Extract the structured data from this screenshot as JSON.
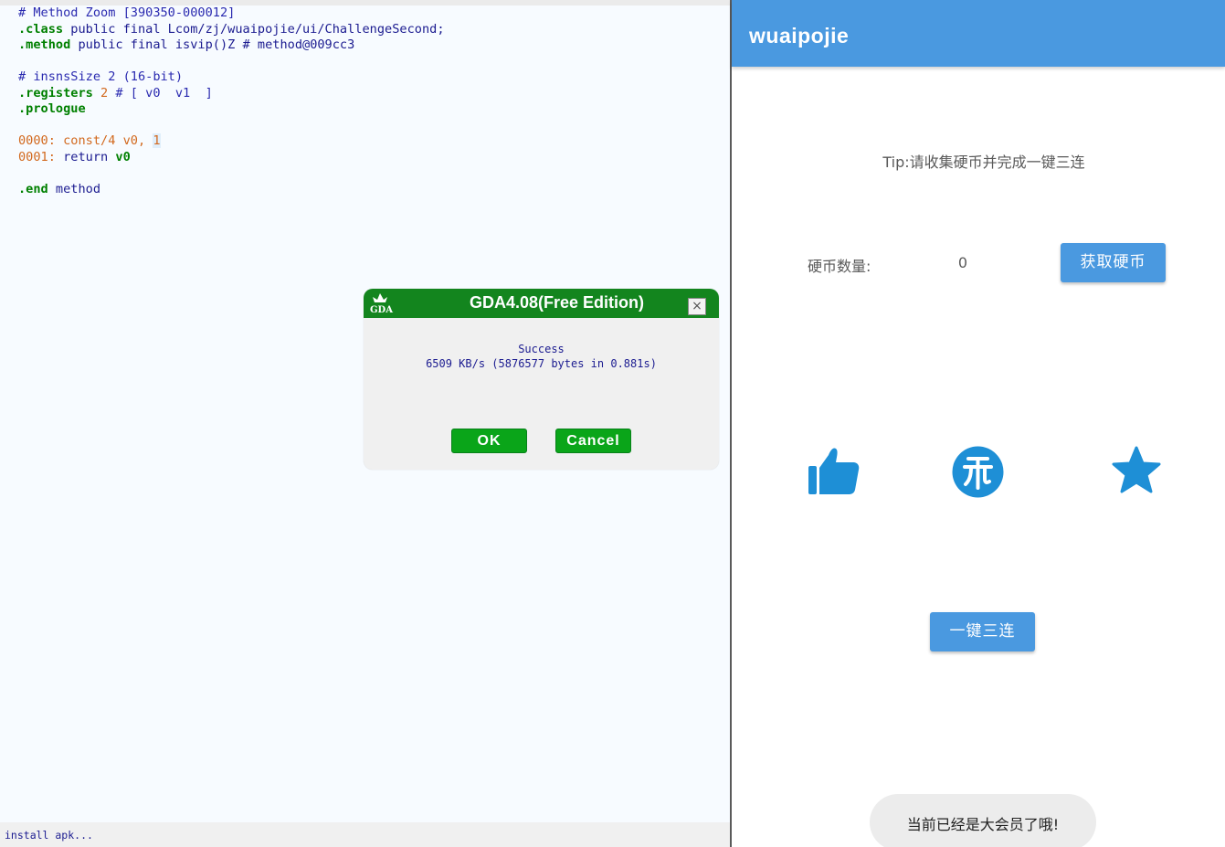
{
  "code_view": {
    "lines": [
      {
        "id": "l1",
        "segments": [
          {
            "cls": "c-comment",
            "text": "# Method Zoom [390350-000012]"
          }
        ]
      },
      {
        "id": "l2",
        "segments": [
          {
            "cls": "c-dir",
            "text": ".class"
          },
          {
            "cls": "c-text",
            "text": " public final Lcom/zj/wuaipojie/ui/ChallengeSecond;"
          }
        ]
      },
      {
        "id": "l3",
        "segments": [
          {
            "cls": "c-dir",
            "text": ".method"
          },
          {
            "cls": "c-text",
            "text": " public final isvip()Z # method@009cc3"
          }
        ]
      },
      {
        "id": "l4",
        "blank": true
      },
      {
        "id": "l5",
        "segments": [
          {
            "cls": "c-comment",
            "text": "# insnsSize 2 (16-bit)"
          }
        ]
      },
      {
        "id": "l6",
        "segments": [
          {
            "cls": "c-dir",
            "text": ".registers"
          },
          {
            "cls": "c-reg",
            "text": " 2"
          },
          {
            "cls": "c-comment",
            "text": " # [ v0  v1  ]"
          }
        ]
      },
      {
        "id": "l7",
        "segments": [
          {
            "cls": "c-dir",
            "text": ".prologue"
          }
        ]
      },
      {
        "id": "l8",
        "blank": true
      },
      {
        "id": "l9",
        "segments": [
          {
            "cls": "c-addr",
            "text": "0000:"
          },
          {
            "cls": "c-op",
            "text": " const/4 v0, "
          },
          {
            "cls": "c-reg c-sel",
            "text": "1"
          }
        ]
      },
      {
        "id": "l10",
        "segments": [
          {
            "cls": "c-addr",
            "text": "0001:"
          },
          {
            "cls": "c-text",
            "text": " return "
          },
          {
            "cls": "c-dir",
            "text": "v0"
          }
        ]
      },
      {
        "id": "l11",
        "blank": true
      },
      {
        "id": "l12",
        "segments": [
          {
            "cls": "c-dir",
            "text": ".end"
          },
          {
            "cls": "c-text",
            "text": " method"
          }
        ]
      }
    ]
  },
  "status_bar": {
    "text": "install apk..."
  },
  "dialog": {
    "logo_text": "GDA",
    "title": "GDA4.08(Free Edition)",
    "close_glyph": "×",
    "message_line1": "Success",
    "message_line2": "6509 KB/s (5876577 bytes in 0.881s)",
    "ok_label": "OK",
    "cancel_label": "Cancel"
  },
  "app": {
    "title": "wuaipojie",
    "tip": "Tip:请收集硬币并完成一键三连",
    "coin_label": "硬币数量:",
    "coin_count": "0",
    "get_coin_button": "获取硬币",
    "triple_button": "一键三连",
    "toast": "当前已经是大会员了哦!",
    "icons": {
      "like": "thumbs-up-icon",
      "coin": "coin-icon",
      "favorite": "star-icon"
    },
    "colors": {
      "accent": "#4a99e0",
      "icon_blue": "#1e8fd6"
    }
  }
}
